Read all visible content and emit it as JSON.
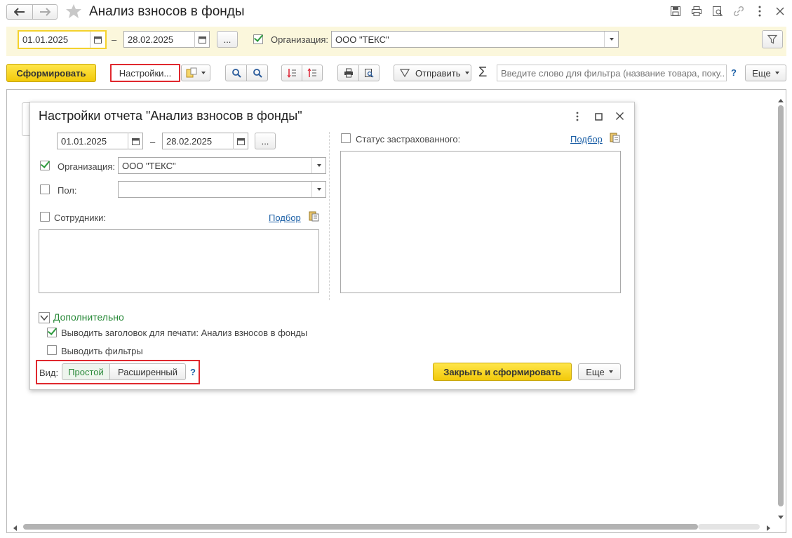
{
  "window": {
    "title": "Анализ взносов в фонды"
  },
  "filter_bar": {
    "date_from": "01.01.2025",
    "date_dash": "–",
    "date_to": "28.02.2025",
    "period_btn": "...",
    "org_label": "Организация:",
    "org_value": "ООО \"ТЕКС\""
  },
  "toolbar": {
    "generate": "Сформировать",
    "settings": "Настройки...",
    "send": "Отправить",
    "sum_symbol": "Σ",
    "search_placeholder": "Введите слово для фильтра (название товара, поку...",
    "help": "?",
    "more": "Еще"
  },
  "dialog": {
    "title": "Настройки отчета \"Анализ взносов в фонды\"",
    "date_from": "01.01.2025",
    "date_dash": "–",
    "date_to": "28.02.2025",
    "period_btn": "...",
    "org_label": "Организация:",
    "org_value": "ООО \"ТЕКС\"",
    "gender_label": "Пол:",
    "gender_value": "",
    "employees_label": "Сотрудники:",
    "pick_link": "Подбор",
    "status_label": "Статус застрахованного:",
    "status_pick_link": "Подбор",
    "extra_group": "Дополнительно",
    "print_title_label": "Выводить заголовок для печати: Анализ взносов в фонды",
    "show_filters_label": "Выводить фильтры",
    "view_label": "Вид:",
    "view_simple": "Простой",
    "view_extended": "Расширенный",
    "help": "?",
    "close_and_generate": "Закрыть и сформировать",
    "more": "Еще",
    "checks": {
      "org": true,
      "gender": false,
      "employees": false,
      "status": false,
      "print_title": true,
      "show_filters": false
    }
  },
  "colors": {
    "accent_yellow": "#f4d22d",
    "highlight_red": "#e0282e",
    "filter_bar_bg": "#fbf7dc",
    "link_blue": "#1b5fa6",
    "group_green": "#2a8a3a"
  }
}
